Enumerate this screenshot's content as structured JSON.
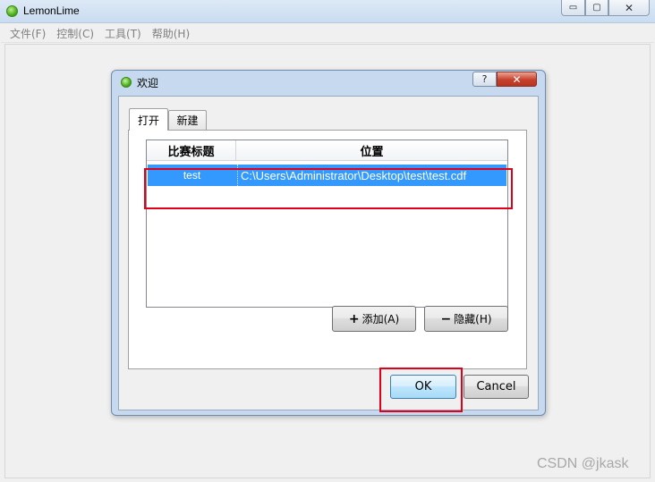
{
  "app": {
    "title": "LemonLime",
    "window_buttons": {
      "minimize": "▭",
      "maximize": "▢",
      "close": "✕"
    }
  },
  "menu": [
    "文件(F)",
    "控制(C)",
    "工具(T)",
    "帮助(H)"
  ],
  "dialog": {
    "title": "欢迎",
    "help_label": "?",
    "close_label": "✕",
    "tabs": [
      {
        "label": "打开",
        "active": true
      },
      {
        "label": "新建",
        "active": false
      }
    ],
    "table": {
      "headers": [
        "比赛标题",
        "位置"
      ],
      "rows": [
        {
          "title": "test",
          "location": "C:\\Users\\Administrator\\Desktop\\test\\test.cdf",
          "selected": true
        }
      ]
    },
    "buttons": {
      "add": {
        "icon": "+",
        "label": "添加(A)"
      },
      "hide": {
        "icon": "−",
        "label": "隐藏(H)"
      },
      "ok": "OK",
      "cancel": "Cancel"
    }
  },
  "watermark": "CSDN @jkask",
  "colors": {
    "selection": "#3399ff",
    "annotation": "#e0001a"
  }
}
